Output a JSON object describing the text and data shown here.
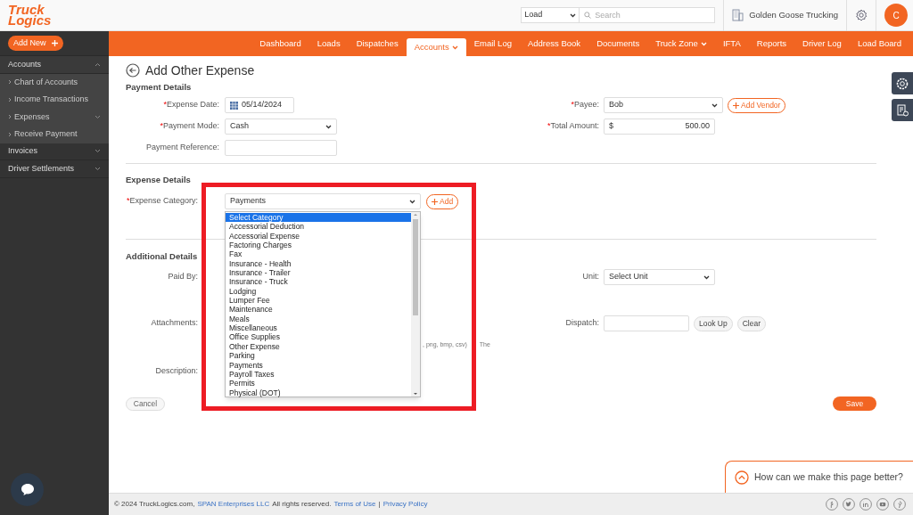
{
  "header": {
    "logo": [
      "Truck",
      "Logics"
    ],
    "search_type": "Load",
    "search": {
      "placeholder": "Search"
    },
    "company": "Golden Goose Trucking",
    "avatar": "C"
  },
  "sidebar": {
    "add_new": "Add New",
    "items": [
      {
        "label": "Accounts",
        "expanded": true,
        "children": [
          {
            "label": "Chart of Accounts",
            "kind": "link"
          },
          {
            "label": "Income Transactions",
            "kind": "link"
          },
          {
            "label": "Expenses",
            "kind": "group"
          },
          {
            "label": "Receive Payment",
            "kind": "link"
          }
        ]
      },
      {
        "label": "Invoices",
        "expanded": false
      },
      {
        "label": "Driver Settlements",
        "expanded": false
      }
    ]
  },
  "nav": [
    {
      "label": "Dashboard",
      "selected": false,
      "has_menu": false
    },
    {
      "label": "Loads",
      "selected": false,
      "has_menu": false
    },
    {
      "label": "Dispatches",
      "selected": false,
      "has_menu": false
    },
    {
      "label": "Accounts",
      "selected": true,
      "has_menu": true
    },
    {
      "label": "Email Log",
      "selected": false,
      "has_menu": false
    },
    {
      "label": "Address Book",
      "selected": false,
      "has_menu": false
    },
    {
      "label": "Documents",
      "selected": false,
      "has_menu": false
    },
    {
      "label": "Truck Zone",
      "selected": false,
      "has_menu": true
    },
    {
      "label": "IFTA",
      "selected": false,
      "has_menu": false
    },
    {
      "label": "Reports",
      "selected": false,
      "has_menu": false
    },
    {
      "label": "Driver Log",
      "selected": false,
      "has_menu": false
    },
    {
      "label": "Load Board",
      "selected": false,
      "has_menu": false
    }
  ],
  "page_title": "Add Other Expense",
  "payment_details": {
    "heading": "Payment Details",
    "expense_date": {
      "required_mark": "*",
      "label": "Expense Date:",
      "value": "05/14/2024"
    },
    "payment_mode": {
      "required_mark": "*",
      "label": "Payment Mode:",
      "value": "Cash"
    },
    "payment_reference": {
      "label": "Payment Reference:"
    },
    "payee": {
      "required_mark": "*",
      "label": "Payee:",
      "value": "Bob",
      "button": "Add Vendor"
    },
    "total_amount": {
      "required_mark": "*",
      "label": "Total Amount:",
      "currency": "$",
      "value": "500.00"
    }
  },
  "expense_details": {
    "heading": "Expense Details",
    "category": {
      "required_mark": "*",
      "label": "Expense Category:",
      "value": "Payments",
      "button": "Add"
    },
    "options": [
      {
        "label": "Select Category",
        "selected": true
      },
      {
        "label": "Accessorial Deduction",
        "selected": false
      },
      {
        "label": "Accessorial Expense",
        "selected": false
      },
      {
        "label": "Factoring Charges",
        "selected": false
      },
      {
        "label": "Fax",
        "selected": false
      },
      {
        "label": "Insurance - Health",
        "selected": false
      },
      {
        "label": "Insurance - Trailer",
        "selected": false
      },
      {
        "label": "Insurance - Truck",
        "selected": false
      },
      {
        "label": "Lodging",
        "selected": false
      },
      {
        "label": "Lumper Fee",
        "selected": false
      },
      {
        "label": "Maintenance",
        "selected": false
      },
      {
        "label": "Meals",
        "selected": false
      },
      {
        "label": "Miscellaneous",
        "selected": false
      },
      {
        "label": "Office Supplies",
        "selected": false
      },
      {
        "label": "Other Expense",
        "selected": false
      },
      {
        "label": "Parking",
        "selected": false
      },
      {
        "label": "Payments",
        "selected": false
      },
      {
        "label": "Payroll Taxes",
        "selected": false
      },
      {
        "label": "Permits",
        "selected": false
      },
      {
        "label": "Physical (DOT)",
        "selected": false
      }
    ]
  },
  "additional_details": {
    "heading": "Additional Details",
    "paid_by": {
      "label": "Paid By:"
    },
    "unit": {
      "label": "Unit:",
      "value": "Select Unit"
    },
    "attachments": {
      "label": "Attachments:",
      "hint": [
        ", png, bmp, csv)",
        "The"
      ]
    },
    "dispatch": {
      "label": "Dispatch:",
      "buttons": [
        "Look Up",
        "Clear"
      ]
    },
    "description": {
      "label": "Description:"
    }
  },
  "buttons": {
    "cancel": "Cancel",
    "save": "Save"
  },
  "feedback": "How can we make this page better?",
  "footer": {
    "copyright": "© 2024 TruckLogics.com,",
    "company_link": "SPAN Enterprises LLC",
    "rights": "All rights reserved.",
    "terms": "Terms of Use",
    "separator": "|",
    "privacy": "Privacy Policy"
  }
}
